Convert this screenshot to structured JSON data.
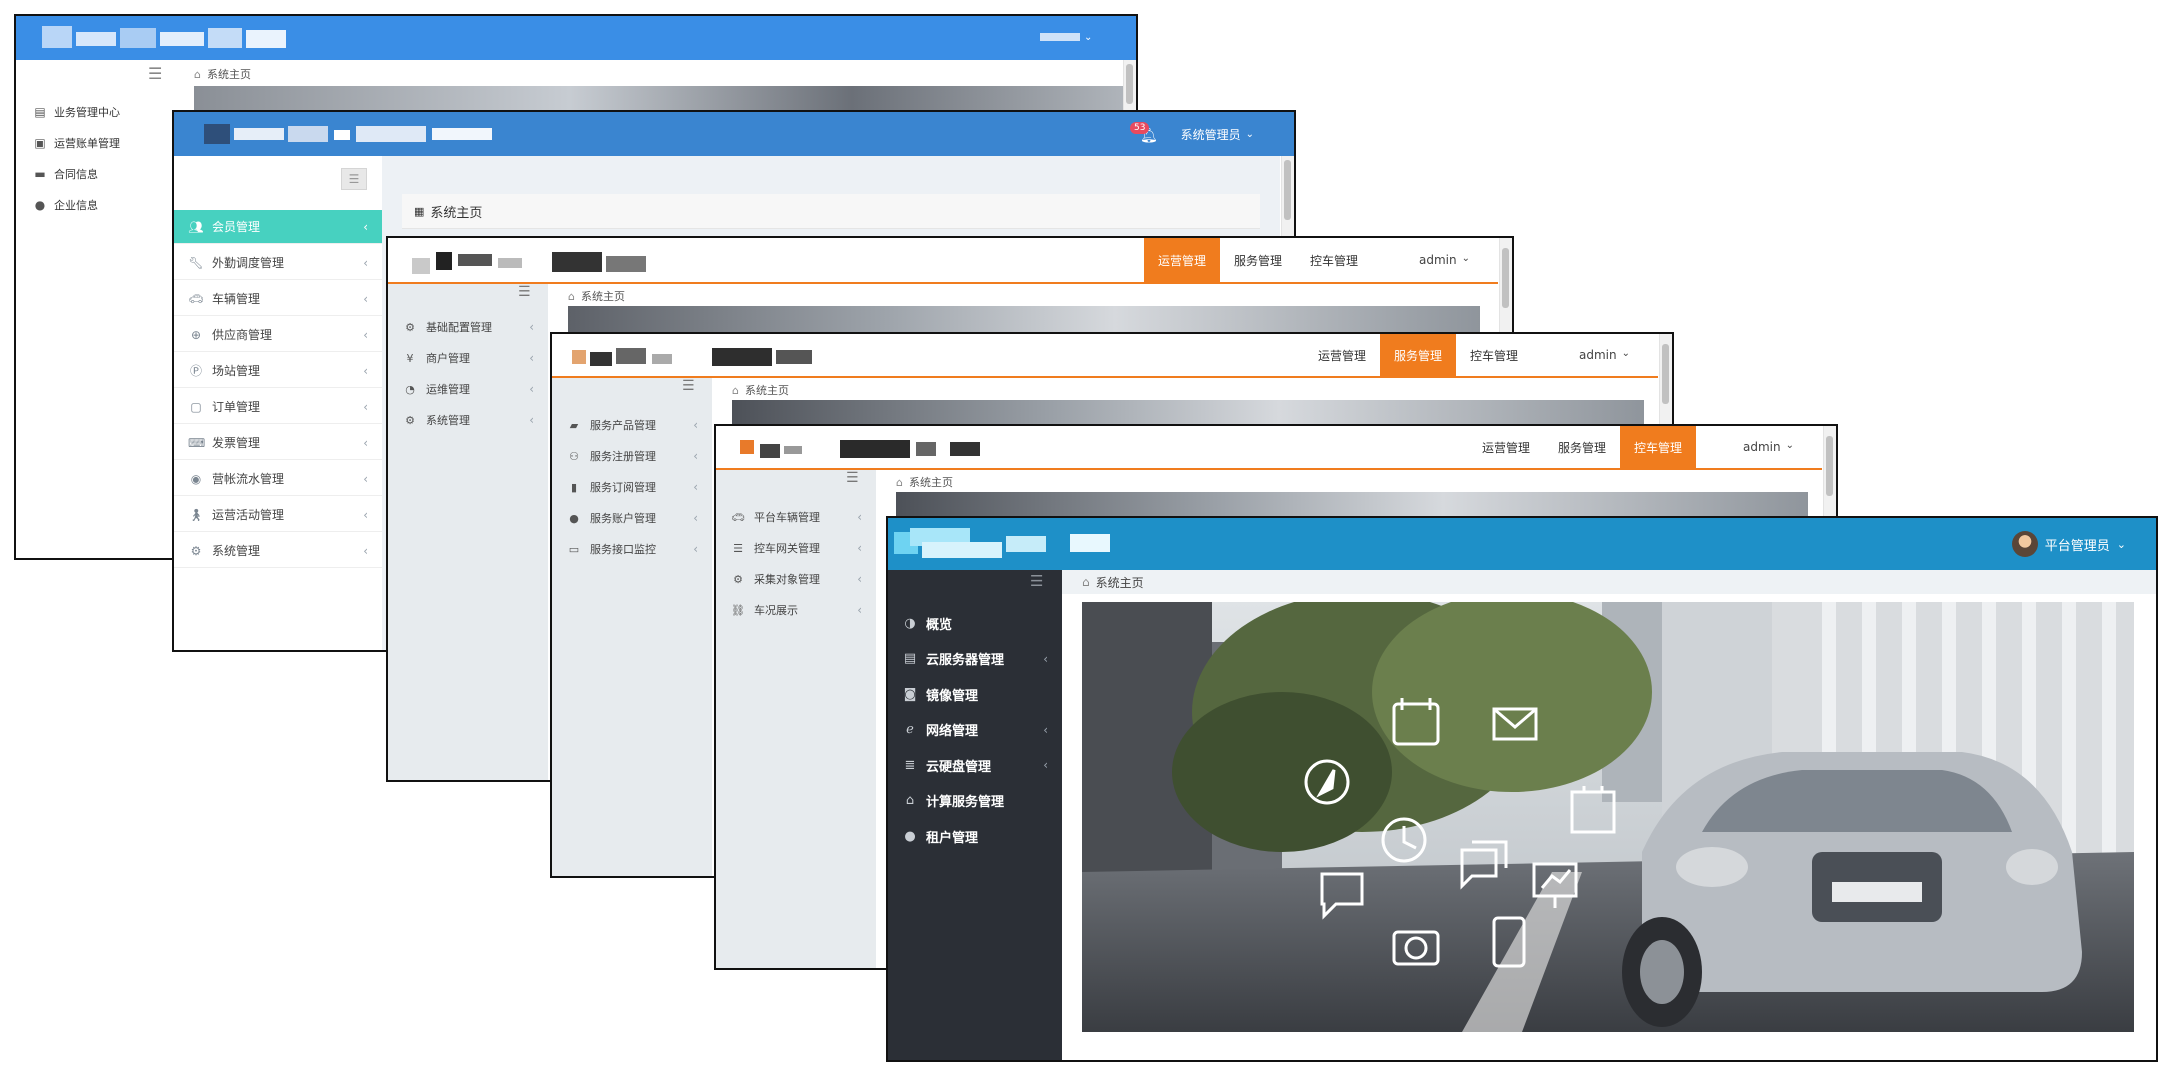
{
  "window1": {
    "breadcrumb": "系统主页",
    "user": "",
    "menu": [
      {
        "label": "业务管理中心",
        "icon": "list-icon"
      },
      {
        "label": "运营账单管理",
        "icon": "money-icon"
      },
      {
        "label": "合同信息",
        "icon": "card-icon"
      },
      {
        "label": "企业信息",
        "icon": "user-icon"
      }
    ],
    "colors": {
      "header": "#3a8ee6"
    }
  },
  "window2": {
    "breadcrumb": "系统主页",
    "user": "系统管理员",
    "badge": "53",
    "menu": [
      {
        "label": "会员管理",
        "icon": "users-icon",
        "active": true
      },
      {
        "label": "外勤调度管理",
        "icon": "wrench-icon"
      },
      {
        "label": "车辆管理",
        "icon": "car-icon"
      },
      {
        "label": "供应商管理",
        "icon": "globe-icon"
      },
      {
        "label": "场站管理",
        "icon": "parking-icon"
      },
      {
        "label": "订单管理",
        "icon": "document-icon"
      },
      {
        "label": "发票管理",
        "icon": "keyboard-icon"
      },
      {
        "label": "营帐流水管理",
        "icon": "circle-icon"
      },
      {
        "label": "运营活动管理",
        "icon": "walker-icon"
      },
      {
        "label": "系统管理",
        "icon": "gear-icon"
      }
    ],
    "colors": {
      "header": "#3a85d0",
      "active": "#47d1c0",
      "badge": "#e84a5f"
    }
  },
  "window3": {
    "breadcrumb": "系统主页",
    "tabs": [
      {
        "label": "运营管理",
        "active": true
      },
      {
        "label": "服务管理",
        "active": false
      },
      {
        "label": "控车管理",
        "active": false
      }
    ],
    "user": "admin",
    "menu": [
      {
        "label": "基础配置管理",
        "icon": "gears-icon"
      },
      {
        "label": "商户管理",
        "icon": "yen-icon"
      },
      {
        "label": "运维管理",
        "icon": "pie-icon"
      },
      {
        "label": "系统管理",
        "icon": "gear-icon"
      }
    ],
    "colors": {
      "accent": "#f07c1e"
    }
  },
  "window4": {
    "breadcrumb": "系统主页",
    "tabs": [
      {
        "label": "运营管理",
        "active": false
      },
      {
        "label": "服务管理",
        "active": true
      },
      {
        "label": "控车管理",
        "active": false
      }
    ],
    "user": "admin",
    "menu": [
      {
        "label": "服务产品管理",
        "icon": "bag-icon"
      },
      {
        "label": "服务注册管理",
        "icon": "user-plus-icon"
      },
      {
        "label": "服务订阅管理",
        "icon": "bookmark-icon"
      },
      {
        "label": "服务账户管理",
        "icon": "user-icon"
      },
      {
        "label": "服务接口监控",
        "icon": "monitor-icon"
      }
    ]
  },
  "window5": {
    "breadcrumb": "系统主页",
    "tabs": [
      {
        "label": "运营管理",
        "active": false
      },
      {
        "label": "服务管理",
        "active": false
      },
      {
        "label": "控车管理",
        "active": true
      }
    ],
    "user": "admin",
    "menu": [
      {
        "label": "平台车辆管理",
        "icon": "car-icon"
      },
      {
        "label": "控车网关管理",
        "icon": "sliders-icon"
      },
      {
        "label": "采集对象管理",
        "icon": "gear-icon"
      },
      {
        "label": "车况展示",
        "icon": "sitemap-icon"
      }
    ]
  },
  "window6": {
    "breadcrumb": "系统主页",
    "user": "平台管理员",
    "menu": [
      {
        "label": "概览",
        "icon": "dashboard-icon",
        "chevron": false
      },
      {
        "label": "云服务器管理",
        "icon": "server-icon",
        "chevron": true
      },
      {
        "label": "镜像管理",
        "icon": "camera-icon",
        "chevron": false
      },
      {
        "label": "网络管理",
        "icon": "ie-icon",
        "chevron": true
      },
      {
        "label": "云硬盘管理",
        "icon": "database-icon",
        "chevron": true
      },
      {
        "label": "计算服务管理",
        "icon": "bank-icon",
        "chevron": false
      },
      {
        "label": "租户管理",
        "icon": "user-icon",
        "chevron": false
      }
    ],
    "colors": {
      "header": "#1e90c8",
      "sidebar": "#2b2f36"
    }
  }
}
